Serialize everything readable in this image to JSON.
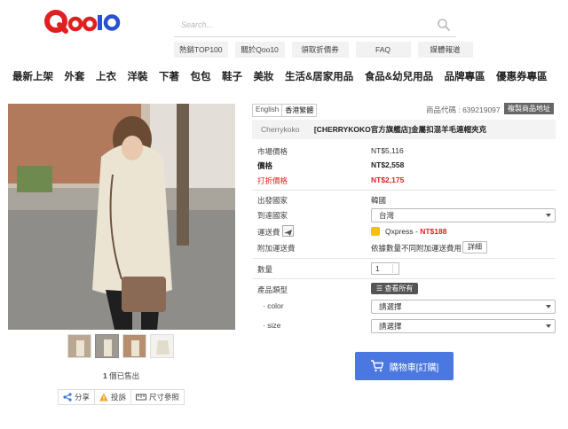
{
  "header": {
    "logo_text": "Qoo10",
    "search_placeholder": "Search...",
    "quick_links": [
      "熱銷TOP100",
      "關於Qoo10",
      "領取折價券",
      "FAQ",
      "媒體報道"
    ]
  },
  "categories": [
    "最新上架",
    "外套",
    "上衣",
    "洋裝",
    "下著",
    "包包",
    "鞋子",
    "美妝",
    "生活&居家用品",
    "食品&幼兒用品",
    "品牌專區",
    "優惠券專區"
  ],
  "gallery": {
    "sold_count": "1",
    "sold_label": " 個已售出",
    "share": "分享",
    "report": "投訴",
    "size_ref": "尺寸參照"
  },
  "product": {
    "lang_options": [
      "English",
      "香港繁體"
    ],
    "code_label": "商品代碼 : 639219097",
    "copy_link": "複製商品地址",
    "brand": "Cherrykoko",
    "name": "[CHERRYKOKO官方旗艦店]金屬扣混羊毛連帽夾克",
    "market_price_label": "市場價格",
    "market_price": "NT$5,116",
    "price_label": "價格",
    "price": "NT$2,558",
    "discount_label": "打折價格",
    "discount_price": "NT$2,175",
    "origin_label": "出發國家",
    "origin": "韓國",
    "dest_label": "到達國家",
    "dest": "台灣",
    "shipping_label": "運送費",
    "shipping_method": "Qxpress - ",
    "shipping_price": "NT$188",
    "extra_fee_label": "附加運送費",
    "extra_fee_text": "依據數量不同附加運送費用",
    "detail_btn": "詳細",
    "qty_label": "數量",
    "qty_value": "1",
    "type_label": "產品類型",
    "view_all": "查看所有",
    "color_label": "· color",
    "color_select": "請選擇",
    "size_label": "· size",
    "size_select": "請選擇",
    "cart_btn": "購物車[訂購]"
  },
  "colors": {
    "logo_red": "#e02020",
    "logo_blue": "#2a4fd0",
    "cart_blue": "#4a78e0",
    "discount_red": "#e02020"
  }
}
